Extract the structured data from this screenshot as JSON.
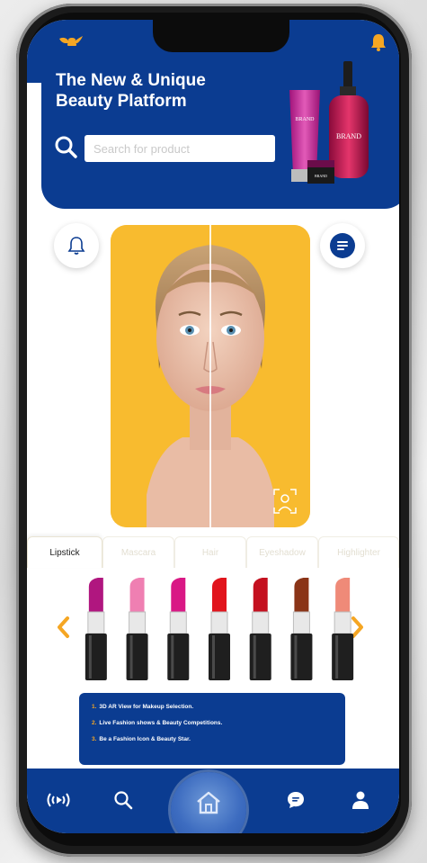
{
  "hero": {
    "title_line1": "The New & Unique",
    "title_line2": "Beauty Platform",
    "product_brand": "BRAND"
  },
  "search": {
    "placeholder": "Search for product"
  },
  "tabs": [
    {
      "label": "Lipstick",
      "active": true
    },
    {
      "label": "Mascara",
      "active": false
    },
    {
      "label": "Hair",
      "active": false
    },
    {
      "label": "Eyeshadow",
      "active": false
    },
    {
      "label": "Highlighter",
      "active": false
    }
  ],
  "lipstick_colors": [
    "#b0167f",
    "#ef7fb2",
    "#d91885",
    "#e1141c",
    "#c4101f",
    "#8a3417",
    "#ef8a78"
  ],
  "info": {
    "items": [
      {
        "num": "1.",
        "text": "3D AR View for Makeup Selection."
      },
      {
        "num": "2.",
        "text": "Live Fashion shows & Beauty Competitions."
      },
      {
        "num": "3.",
        "text": "Be a Fashion Icon & Beauty Star."
      }
    ]
  },
  "colors": {
    "brand_blue": "#0b3c91",
    "accent_orange": "#f5a623",
    "face_background": "#f8bb2f"
  },
  "icons": {
    "top_left": "magic-lamp-icon",
    "top_right": "bell-icon",
    "nav": [
      "live-broadcast-icon",
      "search-icon",
      "home-icon",
      "chat-icon",
      "user-icon"
    ]
  }
}
